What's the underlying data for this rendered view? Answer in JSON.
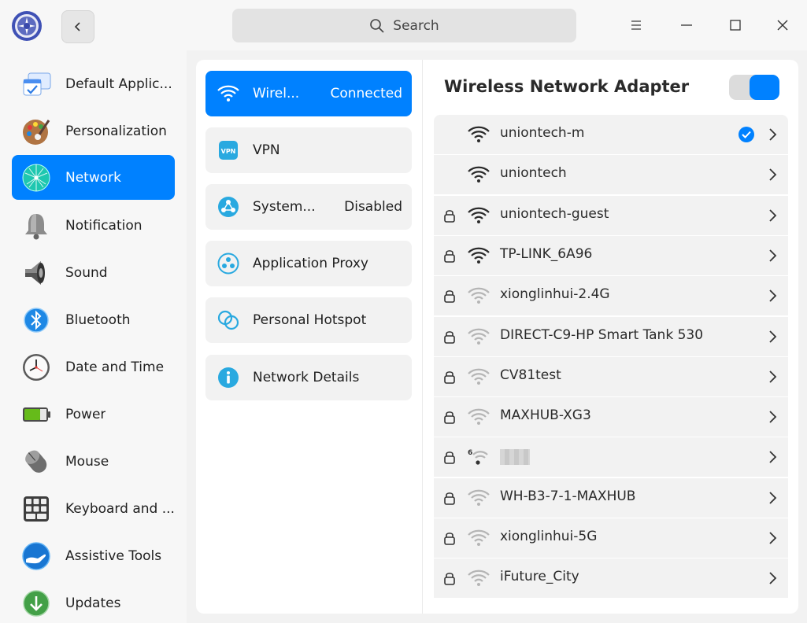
{
  "search": {
    "placeholder": "Search"
  },
  "sidebar": {
    "items": [
      {
        "label": "Default Applic...",
        "icon": "default-apps-icon"
      },
      {
        "label": "Personalization",
        "icon": "palette-icon"
      },
      {
        "label": "Network",
        "icon": "network-globe-icon",
        "active": true
      },
      {
        "label": "Notification",
        "icon": "bell-icon"
      },
      {
        "label": "Sound",
        "icon": "speaker-icon"
      },
      {
        "label": "Bluetooth",
        "icon": "bluetooth-icon"
      },
      {
        "label": "Date and Time",
        "icon": "clock-icon"
      },
      {
        "label": "Power",
        "icon": "battery-icon"
      },
      {
        "label": "Mouse",
        "icon": "mouse-icon"
      },
      {
        "label": "Keyboard and ...",
        "icon": "keyboard-icon"
      },
      {
        "label": "Assistive Tools",
        "icon": "assistive-hand-icon"
      },
      {
        "label": "Updates",
        "icon": "update-arrow-icon"
      }
    ]
  },
  "network_menu": {
    "items": [
      {
        "label": "Wirel...",
        "status": "Connected",
        "icon": "wifi-icon",
        "active": true
      },
      {
        "label": "VPN",
        "status": "",
        "icon": "vpn-icon"
      },
      {
        "label": "System...",
        "status": "Disabled",
        "icon": "system-proxy-icon"
      },
      {
        "label": "Application Proxy",
        "status": "",
        "icon": "app-proxy-icon"
      },
      {
        "label": "Personal Hotspot",
        "status": "",
        "icon": "hotspot-icon"
      },
      {
        "label": "Network Details",
        "status": "",
        "icon": "info-icon"
      }
    ]
  },
  "wireless": {
    "title": "Wireless Network Adapter",
    "enabled": true,
    "networks": [
      {
        "ssid": "uniontech-m",
        "locked": false,
        "connected": true,
        "strength": "strong"
      },
      {
        "ssid": "uniontech",
        "locked": false,
        "connected": false,
        "strength": "strong"
      },
      {
        "ssid": "uniontech-guest",
        "locked": true,
        "connected": false,
        "strength": "strong"
      },
      {
        "ssid": "TP-LINK_6A96",
        "locked": true,
        "connected": false,
        "strength": "strong"
      },
      {
        "ssid": "xionglinhui-2.4G",
        "locked": true,
        "connected": false,
        "strength": "weak"
      },
      {
        "ssid": "DIRECT-C9-HP Smart Tank 530",
        "locked": true,
        "connected": false,
        "strength": "weak"
      },
      {
        "ssid": "CV81test",
        "locked": true,
        "connected": false,
        "strength": "weak"
      },
      {
        "ssid": "MAXHUB-XG3",
        "locked": true,
        "connected": false,
        "strength": "weak"
      },
      {
        "ssid": "",
        "locked": true,
        "connected": false,
        "strength": "wifi6",
        "badge": "6",
        "obscured": true
      },
      {
        "ssid": "WH-B3-7-1-MAXHUB",
        "locked": true,
        "connected": false,
        "strength": "weak"
      },
      {
        "ssid": "xionglinhui-5G",
        "locked": true,
        "connected": false,
        "strength": "weak"
      },
      {
        "ssid": "iFuture_City",
        "locked": true,
        "connected": false,
        "strength": "weak"
      }
    ]
  },
  "colors": {
    "accent": "#0081ff",
    "panel": "#ffffff",
    "background": "#f2f2f2"
  }
}
